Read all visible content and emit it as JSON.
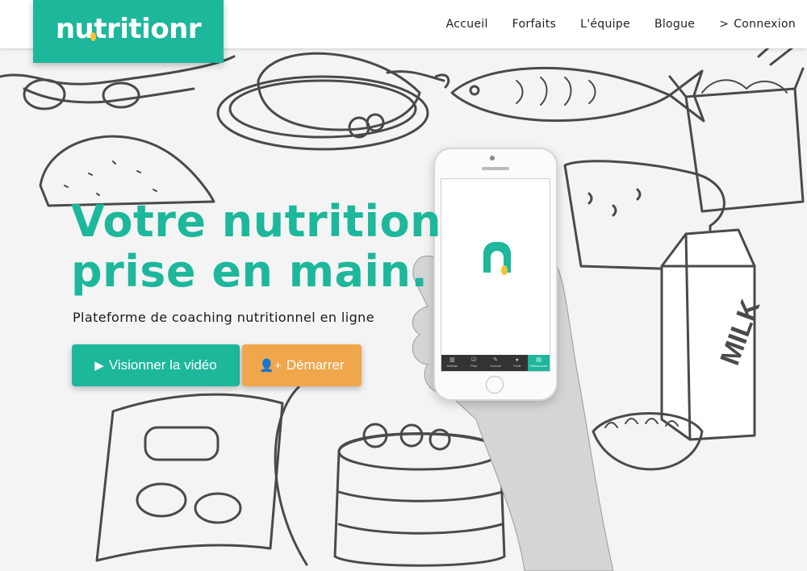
{
  "brand": {
    "name": "nutritionr",
    "color": "#1db79c",
    "accent": "#f6c233"
  },
  "nav": {
    "items": [
      {
        "label": "Accueil"
      },
      {
        "label": "Forfaits"
      },
      {
        "label": "L'équipe"
      },
      {
        "label": "Blogue"
      },
      {
        "label": "Connexion",
        "icon": "chevron-right-icon"
      }
    ]
  },
  "hero": {
    "title_line1": "Votre nutrition",
    "title_line2": "prise en main.",
    "subtitle": "Plateforme de coaching nutritionnel en ligne",
    "buttons": {
      "video": {
        "label": "Visionner la vidéo",
        "icon": "play-icon",
        "color": "#1db79c"
      },
      "start": {
        "label": "Démarrer",
        "icon": "add-user-icon",
        "color": "#f0a64a"
      }
    }
  },
  "phone_app": {
    "tabs": [
      {
        "label": "Tableau",
        "icon": "chart-icon"
      },
      {
        "label": "Plan",
        "icon": "check-icon"
      },
      {
        "label": "Journal",
        "icon": "pen-icon"
      },
      {
        "label": "Profil",
        "icon": "user-icon"
      },
      {
        "label": "Ressources",
        "icon": "book-icon",
        "active": true
      }
    ]
  },
  "background": {
    "milk_carton_label": "MILK"
  }
}
